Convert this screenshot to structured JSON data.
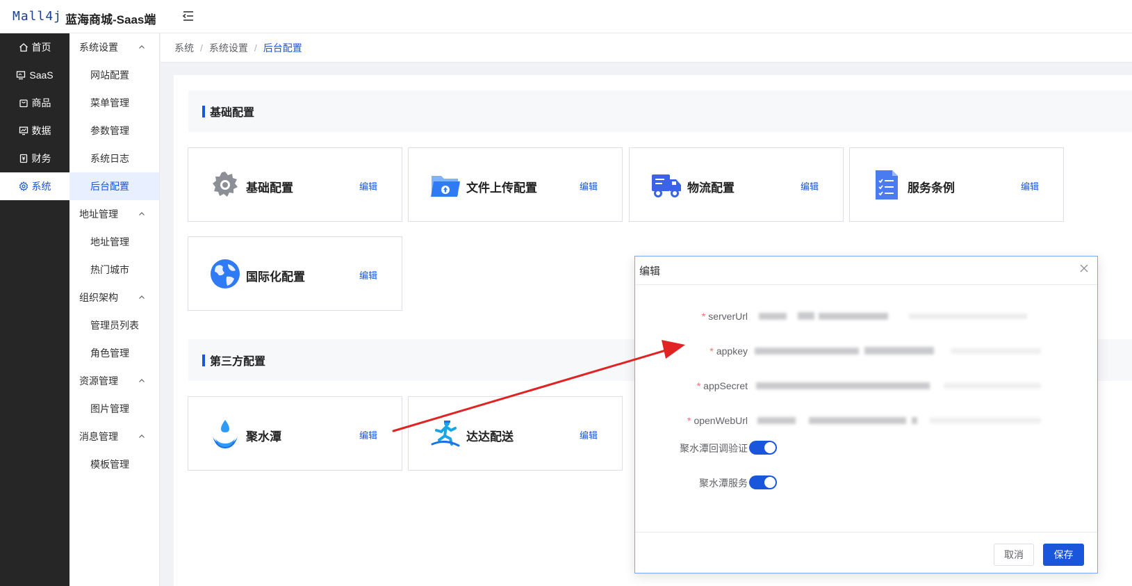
{
  "header": {
    "logo": "Mall4j",
    "title": "蓝海商城-Saas端"
  },
  "nav": [
    {
      "label": "首页",
      "icon": "home-icon"
    },
    {
      "label": "SaaS",
      "icon": "monitor-icon"
    },
    {
      "label": "商品",
      "icon": "bag-icon"
    },
    {
      "label": "数据",
      "icon": "chart-icon"
    },
    {
      "label": "财务",
      "icon": "ledger-icon"
    },
    {
      "label": "系统",
      "icon": "gear-icon",
      "active": true
    }
  ],
  "subnav": [
    {
      "group": "系统设置",
      "items": [
        "网站配置",
        "菜单管理",
        "参数管理",
        "系统日志",
        "后台配置"
      ]
    },
    {
      "group": "地址管理",
      "items": [
        "地址管理",
        "热门城市"
      ]
    },
    {
      "group": "组织架构",
      "items": [
        "管理员列表",
        "角色管理"
      ]
    },
    {
      "group": "资源管理",
      "items": [
        "图片管理"
      ]
    },
    {
      "group": "消息管理",
      "items": [
        "模板管理"
      ]
    }
  ],
  "subnav_active": "后台配置",
  "breadcrumb": [
    "系统",
    "系统设置",
    "后台配置"
  ],
  "sections": {
    "basic": "基础配置",
    "third_party": "第三方配置"
  },
  "cards": {
    "basic_config": {
      "name": "基础配置",
      "edit": "编辑"
    },
    "upload_config": {
      "name": "文件上传配置",
      "edit": "编辑"
    },
    "logistics_config": {
      "name": "物流配置",
      "edit": "编辑"
    },
    "service_terms": {
      "name": "服务条例",
      "edit": "编辑"
    },
    "i18n_config": {
      "name": "国际化配置",
      "edit": "编辑"
    },
    "jushuitan": {
      "name": "聚水潭",
      "edit": "编辑"
    },
    "dada": {
      "name": "达达配送",
      "edit": "编辑"
    }
  },
  "dialog": {
    "title": "编辑",
    "fields": {
      "server_url": "serverUrl",
      "appkey": "appkey",
      "app_secret": "appSecret",
      "open_web_url": "openWebUrl"
    },
    "required_mark": "*",
    "toggles": {
      "callback_verify": {
        "label": "聚水潭回调验证",
        "on": true
      },
      "service": {
        "label": "聚水潭服务",
        "on": true
      }
    },
    "cancel_label": "取消",
    "save_label": "保存"
  },
  "colors": {
    "accent": "#1a56db",
    "sidebar_dark": "#262626",
    "annotation_arrow": "#e02424"
  }
}
